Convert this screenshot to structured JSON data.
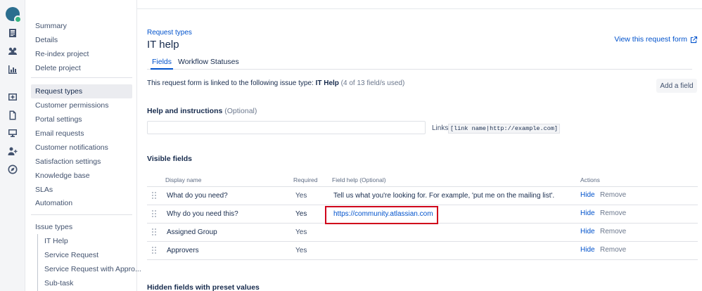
{
  "sidebar": {
    "items": [
      "Summary",
      "Details",
      "Re-index project",
      "Delete project"
    ],
    "settings": [
      "Request types",
      "Customer permissions",
      "Portal settings",
      "Email requests",
      "Customer notifications",
      "Satisfaction settings",
      "Knowledge base",
      "SLAs",
      "Automation"
    ],
    "issue_types_label": "Issue types",
    "issue_types": [
      "IT Help",
      "Service Request",
      "Service Request with Appro...",
      "Sub-task"
    ]
  },
  "header": {
    "breadcrumb": "Request types",
    "title": "IT help",
    "view_form_link": "View this request form"
  },
  "tabs": [
    "Fields",
    "Workflow Statuses"
  ],
  "linked": {
    "prefix": "This request form is linked to the following issue type: ",
    "issue_type": "IT Help",
    "count": " (4 of 13 field/s used)"
  },
  "add_field_button": "Add a field",
  "help": {
    "label": "Help and instructions",
    "optional": " (Optional)",
    "value": "",
    "links_label": "Links",
    "links_syntax": "[link name|http://example.com]"
  },
  "visible_fields": {
    "title": "Visible fields",
    "columns": [
      "Display name",
      "Required",
      "Field help (Optional)",
      "Actions"
    ],
    "rows": [
      {
        "name": "What do you need?",
        "required": "Yes",
        "help": "Tell us what you're looking for. For example, 'put me on the mailing list'.",
        "hide": "Hide",
        "remove": "Remove"
      },
      {
        "name": "Why do you need this?",
        "required": "Yes",
        "help": "https://community.atlassian.com",
        "hide": "Hide",
        "remove": "Remove"
      },
      {
        "name": "Assigned Group",
        "required": "Yes",
        "help": "",
        "hide": "Hide",
        "remove": "Remove"
      },
      {
        "name": "Approvers",
        "required": "Yes",
        "help": "",
        "hide": "Hide",
        "remove": "Remove"
      }
    ]
  },
  "hidden_fields_title": "Hidden fields with preset values",
  "colors": {
    "accent": "#0052cc",
    "highlight": "#d0021b"
  }
}
